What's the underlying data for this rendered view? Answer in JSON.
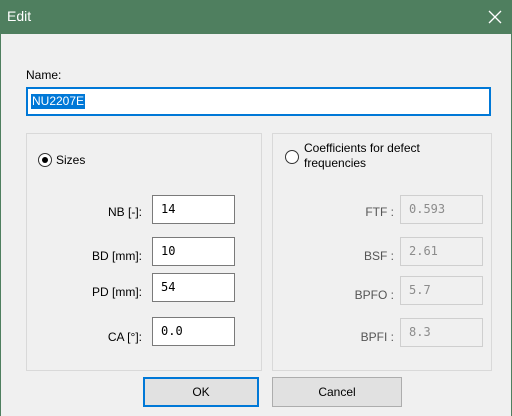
{
  "window": {
    "title": "Edit"
  },
  "name": {
    "label": "Name:",
    "value": "NU2207E"
  },
  "sizes": {
    "label": "Sizes",
    "selected": true,
    "fields": [
      {
        "label": "NB [-]:",
        "value": "14"
      },
      {
        "label": "BD [mm]:",
        "value": "10"
      },
      {
        "label": "PD [mm]:",
        "value": "54"
      },
      {
        "label": "CA [°]:",
        "value": "0.0"
      }
    ]
  },
  "coefficients": {
    "label_line1": "Coefficients for defect",
    "label_line2": "frequencies",
    "selected": false,
    "fields": [
      {
        "label": "FTF :",
        "value": "0.593"
      },
      {
        "label": "BSF :",
        "value": "2.61"
      },
      {
        "label": "BPFO :",
        "value": "5.7"
      },
      {
        "label": "BPFI :",
        "value": "8.3"
      }
    ]
  },
  "buttons": {
    "ok": "OK",
    "cancel": "Cancel"
  },
  "colors": {
    "titlebar": "#4f7f5f",
    "accent": "#0078d7"
  },
  "icons": {
    "close": "close-icon"
  }
}
